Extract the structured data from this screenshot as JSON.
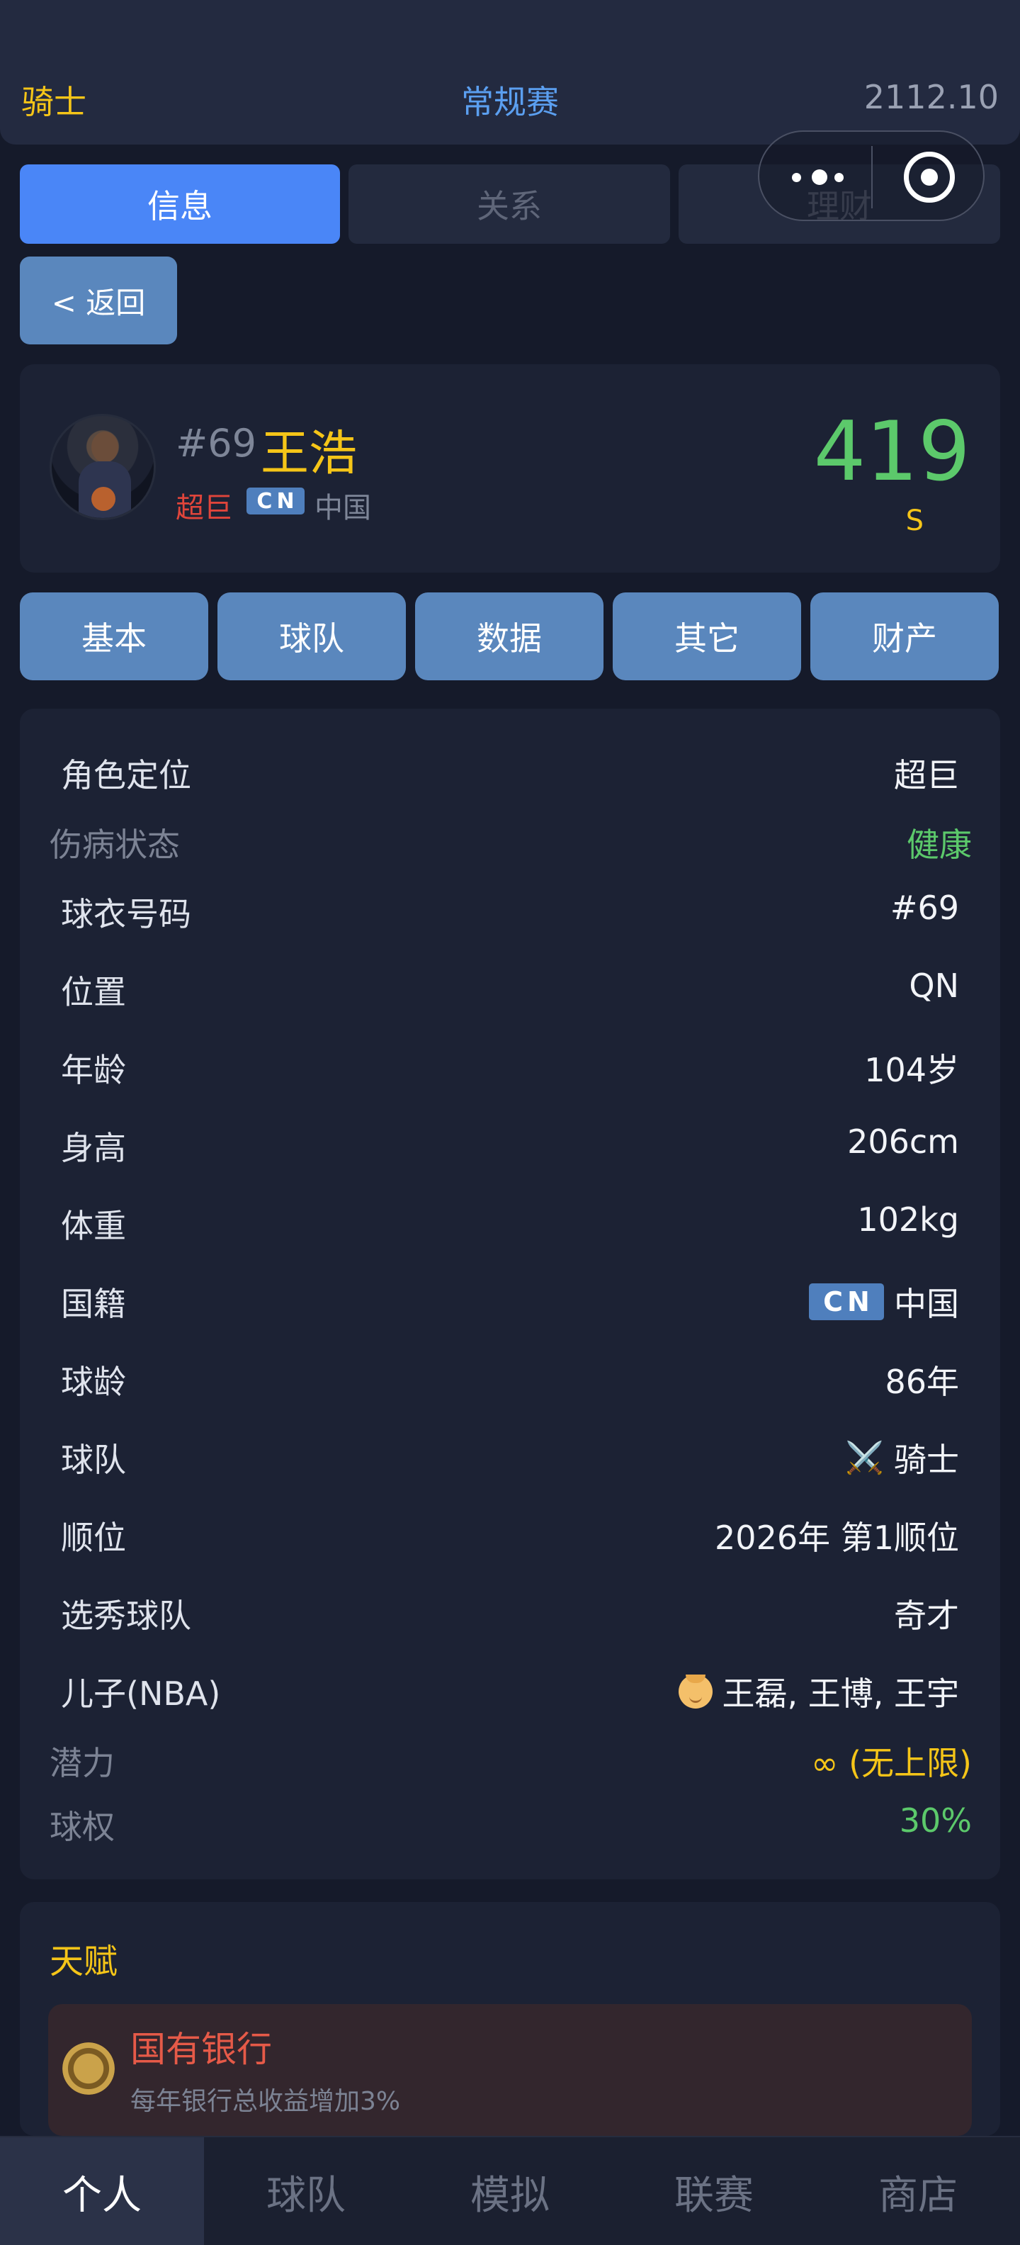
{
  "header": {
    "team": "骑士",
    "season": "常规赛",
    "money": "2112.10"
  },
  "top_tabs": [
    {
      "label": "信息",
      "active": true
    },
    {
      "label": "关系",
      "active": false
    },
    {
      "label": "理财",
      "active": false
    }
  ],
  "back_label": "< 返回",
  "profile": {
    "number": "#69",
    "name": "王浩",
    "role": "超巨",
    "flag_text": [
      "C",
      "N"
    ],
    "country": "中国",
    "rating": "419",
    "grade": "S"
  },
  "sub_tabs": [
    "基本",
    "球队",
    "数据",
    "其它",
    "财产"
  ],
  "info_rows": {
    "role": {
      "label": "角色定位",
      "value": "超巨"
    },
    "injury": {
      "label": "伤病状态",
      "value": "健康"
    },
    "jersey": {
      "label": "球衣号码",
      "value": "#69"
    },
    "position": {
      "label": "位置",
      "value": "QN"
    },
    "age": {
      "label": "年龄",
      "value": "104岁"
    },
    "height": {
      "label": "身高",
      "value": "206cm"
    },
    "weight": {
      "label": "体重",
      "value": "102kg"
    },
    "nationality": {
      "label": "国籍",
      "value": "中国",
      "flag": [
        "C",
        "N"
      ]
    },
    "seniority": {
      "label": "球龄",
      "value": "86年"
    },
    "team": {
      "label": "球队",
      "value": "骑士",
      "icon": "⚔️"
    },
    "draft": {
      "label": "顺位",
      "value": "2026年 第1顺位"
    },
    "draft_team": {
      "label": "选秀球队",
      "value": "奇才"
    },
    "sons": {
      "label": "儿子(NBA)",
      "value": "王磊, 王博, 王宇"
    },
    "potential": {
      "label": "潜力",
      "value": "∞ (无上限)"
    },
    "equity": {
      "label": "球权",
      "value": "30%"
    }
  },
  "talent": {
    "title": "天赋",
    "name": "国有银行",
    "desc": "每年银行总收益增加3%"
  },
  "bottom_nav": [
    {
      "label": "个人",
      "active": true
    },
    {
      "label": "球队",
      "active": false
    },
    {
      "label": "模拟",
      "active": false
    },
    {
      "label": "联赛",
      "active": false
    },
    {
      "label": "商店",
      "active": false
    }
  ],
  "colors": {
    "accent_blue": "#4a86f7",
    "gold": "#f5c518",
    "green": "#5cc96b",
    "red": "#e0453b"
  }
}
